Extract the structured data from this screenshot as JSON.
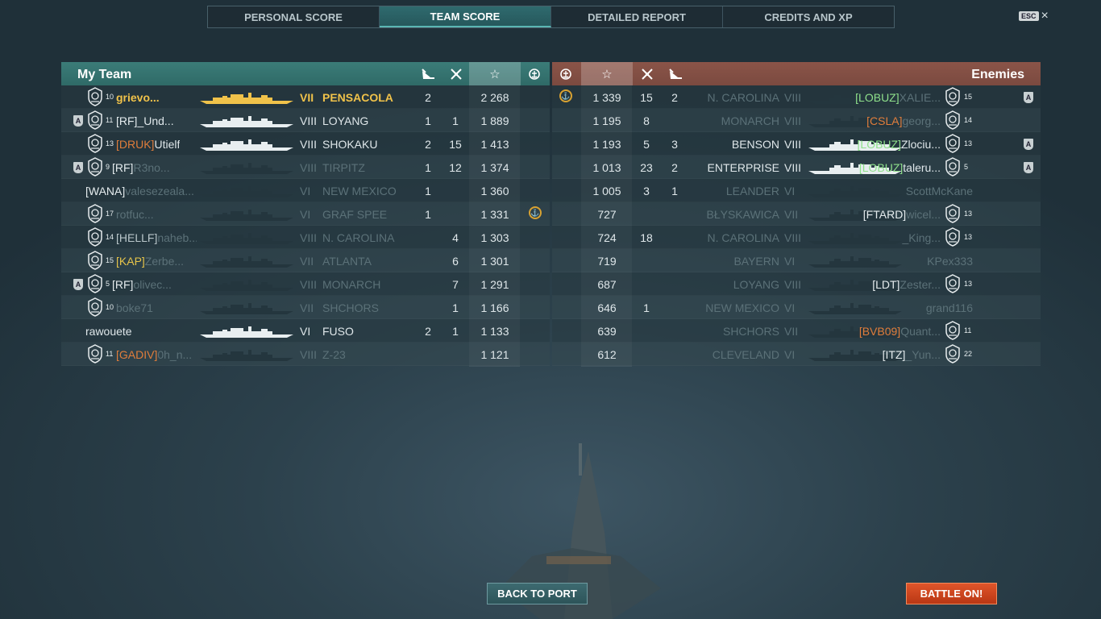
{
  "tabs": [
    "PERSONAL SCORE",
    "TEAM SCORE",
    "DETAILED REPORT",
    "CREDITS AND XP"
  ],
  "esc": {
    "key": "ESC",
    "close": "×"
  },
  "my_team": {
    "title": "My Team",
    "header_icons": [
      "torpedo-hit-icon",
      "ship-kill-icon",
      "star-icon",
      "base-capture-icon"
    ],
    "header_star": "☆",
    "rows": [
      {
        "a": false,
        "rank": "10",
        "clan": "",
        "clan_color": "",
        "name": "grievo...",
        "tier": "VII",
        "ship": "PENSACOLA",
        "c1": "2",
        "c2": "",
        "score": "2 268",
        "medal": false,
        "state": "me",
        "sil": "yellow"
      },
      {
        "a": true,
        "rank": "11",
        "clan": "[RF]",
        "clan_color": "",
        "name": "_Und...",
        "tier": "VIII",
        "ship": "LOYANG",
        "c1": "1",
        "c2": "1",
        "score": "1 889",
        "medal": false,
        "state": "alive",
        "sil": "white"
      },
      {
        "a": false,
        "rank": "13",
        "clan": "[DRUK]",
        "clan_color": "orange",
        "name": "Utielf",
        "tier": "VIII",
        "ship": "SHOKAKU",
        "c1": "2",
        "c2": "15",
        "score": "1 413",
        "medal": false,
        "state": "alive",
        "sil": "white"
      },
      {
        "a": true,
        "rank": "9",
        "clan": "[RF]",
        "clan_color": "",
        "name": "R3no...",
        "tier": "VIII",
        "ship": "TIRPITZ",
        "c1": "1",
        "c2": "12",
        "score": "1 374",
        "medal": false,
        "state": "dead",
        "sil": "dark"
      },
      {
        "a": false,
        "rank": "",
        "clan": "[WANA]",
        "clan_color": "",
        "name": "valesezeala...",
        "tier": "VI",
        "ship": "NEW MEXICO",
        "c1": "1",
        "c2": "",
        "score": "1 360",
        "medal": false,
        "state": "dead",
        "sil": "dark"
      },
      {
        "a": false,
        "rank": "17",
        "clan": "",
        "clan_color": "",
        "name": "rotfuc...",
        "tier": "VI",
        "ship": "GRAF SPEE",
        "c1": "1",
        "c2": "",
        "score": "1 331",
        "medal": true,
        "state": "dead",
        "sil": "dark"
      },
      {
        "a": false,
        "rank": "14",
        "clan": "[HELLF]",
        "clan_color": "gray",
        "name": "naheb...",
        "tier": "VIII",
        "ship": "N. CAROLINA",
        "c1": "",
        "c2": "4",
        "score": "1 303",
        "medal": false,
        "state": "dead",
        "sil": "dark"
      },
      {
        "a": false,
        "rank": "15",
        "clan": "[KAP]",
        "clan_color": "yellow",
        "name": "Zerbe...",
        "tier": "VII",
        "ship": "ATLANTA",
        "c1": "",
        "c2": "6",
        "score": "1 301",
        "medal": false,
        "state": "dead",
        "sil": "dark"
      },
      {
        "a": true,
        "rank": "5",
        "clan": "[RF]",
        "clan_color": "",
        "name": "olivec...",
        "tier": "VIII",
        "ship": "MONARCH",
        "c1": "",
        "c2": "7",
        "score": "1 291",
        "medal": false,
        "state": "dead",
        "sil": "dark"
      },
      {
        "a": false,
        "rank": "10",
        "clan": "",
        "clan_color": "",
        "name": "boke71",
        "tier": "VII",
        "ship": "SHCHORS",
        "c1": "",
        "c2": "1",
        "score": "1 166",
        "medal": false,
        "state": "dead",
        "sil": "dark"
      },
      {
        "a": false,
        "rank": "",
        "clan": "",
        "clan_color": "",
        "name": "rawouete",
        "tier": "VI",
        "ship": "FUSO",
        "c1": "2",
        "c2": "1",
        "score": "1 133",
        "medal": false,
        "state": "alive",
        "sil": "white"
      },
      {
        "a": false,
        "rank": "11",
        "clan": "[GADIV]",
        "clan_color": "orange",
        "name": "0h_n...",
        "tier": "VIII",
        "ship": "Z-23",
        "c1": "",
        "c2": "",
        "score": "1 121",
        "medal": false,
        "state": "dead",
        "sil": "dark"
      }
    ]
  },
  "enemies": {
    "title": "Enemies",
    "header_icons": [
      "base-capture-icon",
      "star-icon",
      "ship-kill-icon",
      "torpedo-hit-icon"
    ],
    "header_star": "☆",
    "rows": [
      {
        "medal": true,
        "score": "1 339",
        "c2": "15",
        "c1": "2",
        "ship": "N. CAROLINA",
        "tier": "VIII",
        "clan": "[LOBUZ]",
        "clan_color": "green",
        "name": "XALIE...",
        "rank": "15",
        "a": true,
        "state": "dead",
        "sil": "dark"
      },
      {
        "medal": false,
        "score": "1 195",
        "c2": "8",
        "c1": "",
        "ship": "MONARCH",
        "tier": "VIII",
        "clan": "[CSLA]",
        "clan_color": "orange",
        "name": "georg...",
        "rank": "14",
        "a": false,
        "state": "dead",
        "sil": "dark"
      },
      {
        "medal": false,
        "score": "1 193",
        "c2": "5",
        "c1": "3",
        "ship": "BENSON",
        "tier": "VIII",
        "clan": "[LOBUZ]",
        "clan_color": "green",
        "name": "Zlociu...",
        "rank": "13",
        "a": true,
        "state": "alive",
        "sil": "white"
      },
      {
        "medal": false,
        "score": "1 013",
        "c2": "23",
        "c1": "2",
        "ship": "ENTERPRISE",
        "tier": "VIII",
        "clan": "[LOBUZ]",
        "clan_color": "green",
        "name": "taleru...",
        "rank": "5",
        "a": true,
        "state": "alive",
        "sil": "white"
      },
      {
        "medal": false,
        "score": "1 005",
        "c2": "3",
        "c1": "1",
        "ship": "LEANDER",
        "tier": "VI",
        "clan": "",
        "clan_color": "",
        "name": "ScottMcKane",
        "rank": "",
        "a": false,
        "state": "dead",
        "sil": "dark"
      },
      {
        "medal": false,
        "score": "727",
        "c2": "",
        "c1": "",
        "ship": "BŁYSKAWICA",
        "tier": "VII",
        "clan": "[FTARD]",
        "clan_color": "",
        "name": "wicel...",
        "rank": "13",
        "a": false,
        "state": "dead",
        "sil": "dark"
      },
      {
        "medal": false,
        "score": "724",
        "c2": "18",
        "c1": "",
        "ship": "N. CAROLINA",
        "tier": "VIII",
        "clan": "",
        "clan_color": "",
        "name": "_King...",
        "rank": "13",
        "a": false,
        "state": "dead",
        "sil": "dark"
      },
      {
        "medal": false,
        "score": "719",
        "c2": "",
        "c1": "",
        "ship": "BAYERN",
        "tier": "VI",
        "clan": "",
        "clan_color": "",
        "name": "KPex333",
        "rank": "",
        "a": false,
        "state": "dead",
        "sil": "dark"
      },
      {
        "medal": false,
        "score": "687",
        "c2": "",
        "c1": "",
        "ship": "LOYANG",
        "tier": "VIII",
        "clan": "[LDT]",
        "clan_color": "",
        "name": "Zester...",
        "rank": "13",
        "a": false,
        "state": "dead",
        "sil": "dark"
      },
      {
        "medal": false,
        "score": "646",
        "c2": "1",
        "c1": "",
        "ship": "NEW MEXICO",
        "tier": "VI",
        "clan": "",
        "clan_color": "",
        "name": "grand116",
        "rank": "",
        "a": false,
        "state": "dead",
        "sil": "dark"
      },
      {
        "medal": false,
        "score": "639",
        "c2": "",
        "c1": "",
        "ship": "SHCHORS",
        "tier": "VII",
        "clan": "[BVB09]",
        "clan_color": "orange",
        "name": "Quant...",
        "rank": "11",
        "a": false,
        "state": "dead",
        "sil": "dark"
      },
      {
        "medal": false,
        "score": "612",
        "c2": "",
        "c1": "",
        "ship": "CLEVELAND",
        "tier": "VI",
        "clan": "[ITZ]",
        "clan_color": "",
        "name": "_Yun...",
        "rank": "22",
        "a": false,
        "state": "dead",
        "sil": "dark"
      }
    ]
  },
  "colors": {
    "yellow": "#f0c24a",
    "white": "#e8eef0",
    "dark": "#24363e",
    "medal": "#d8a232"
  },
  "buttons": {
    "back": "BACK TO PORT",
    "battle": "BATTLE ON!"
  }
}
